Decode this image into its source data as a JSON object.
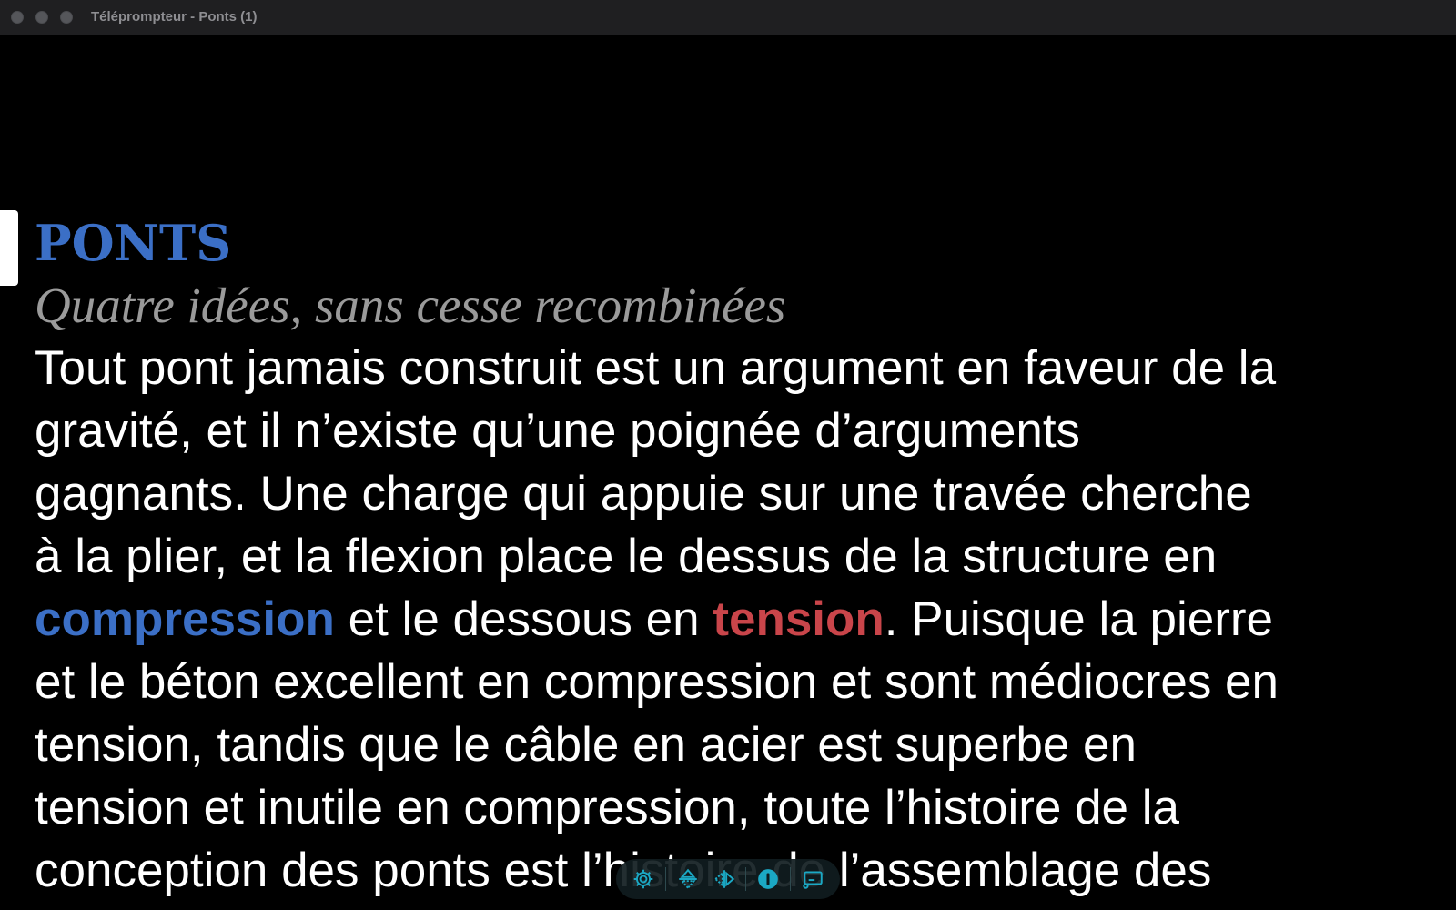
{
  "window": {
    "title": "Téléprompteur - Ponts (1)"
  },
  "document": {
    "heading": "PONTS",
    "subheading": "Quatre idées, sans cesse recombinées",
    "lines": [
      "Tout pont jamais construit est un argument en faveur de la",
      "gravité, et il n’existe qu’une poignée d’arguments",
      "gagnants. Une charge qui appuie sur une travée cherche",
      "à la plier, et la flexion place le dessus de la structure en"
    ],
    "line5": {
      "term_compression": "compression",
      "mid": " et le dessous en ",
      "term_tension": "tension",
      "end": ". Puisque la pierre"
    },
    "lines_after": [
      "et le béton excellent en compression et sont médiocres en",
      "tension, tandis que le câble en acier est superbe en",
      "tension et inutile en compression, toute l’histoire de la",
      "conception des ponts est l’histoire de l’assemblage des"
    ]
  },
  "toolbar": {
    "buttons": [
      "settings-icon",
      "flip-vertical-icon",
      "flip-horizontal-icon",
      "start-pause-icon",
      "display-icon"
    ]
  },
  "colors": {
    "accent_blue": "#3b6fc6",
    "accent_red": "#c9454a",
    "toolbar_icon": "#1ba8c4"
  }
}
